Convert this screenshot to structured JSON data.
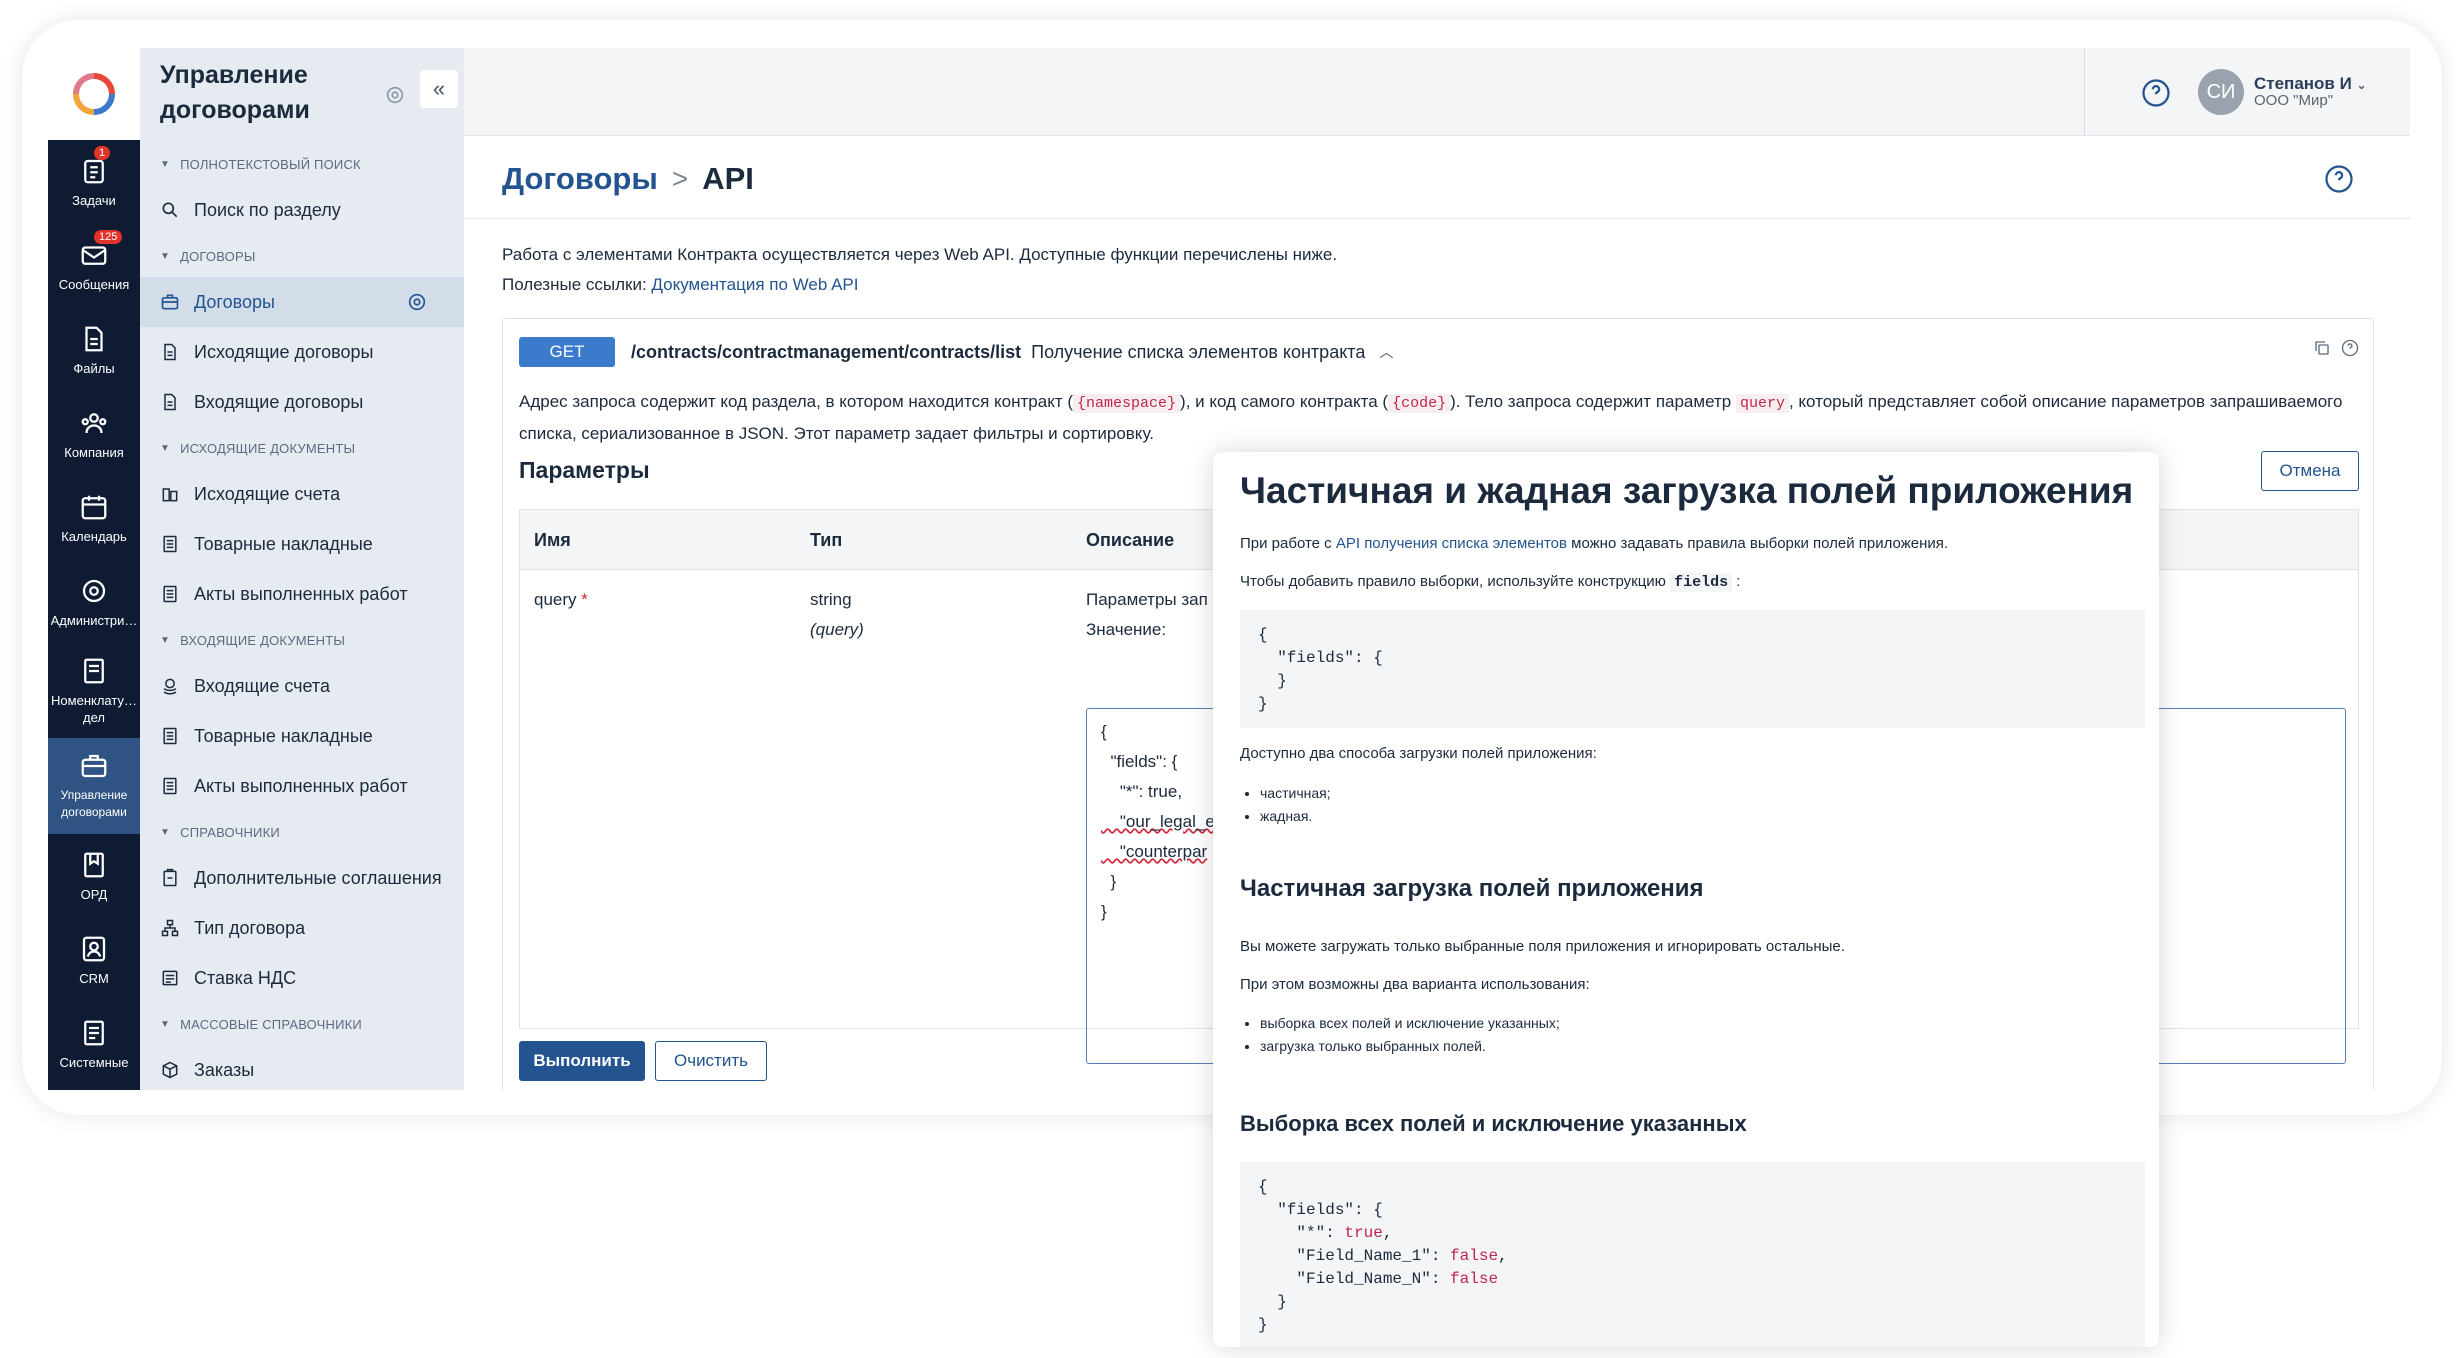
{
  "rail": {
    "items": [
      {
        "label": "Задачи",
        "icon": "tasks-icon",
        "badge": "1"
      },
      {
        "label": "Сообщения",
        "icon": "messages-icon",
        "badge": "125"
      },
      {
        "label": "Файлы",
        "icon": "files-icon",
        "badge": ""
      },
      {
        "label": "Компания",
        "icon": "company-icon",
        "badge": ""
      },
      {
        "label": "Календарь",
        "icon": "calendar-icon",
        "badge": ""
      },
      {
        "label": "Администри…",
        "icon": "admin-gear-icon",
        "badge": ""
      },
      {
        "label": "Номенклату… дел",
        "icon": "nomenclature-icon",
        "badge": ""
      },
      {
        "label": "Управление договорами",
        "icon": "contracts-icon",
        "badge": ""
      },
      {
        "label": "ОРД",
        "icon": "ord-icon",
        "badge": ""
      },
      {
        "label": "CRM",
        "icon": "crm-icon",
        "badge": ""
      },
      {
        "label": "Системные",
        "icon": "system-icon",
        "badge": ""
      }
    ]
  },
  "sidebar": {
    "title": "Управление договорами",
    "collapse_glyph": "«",
    "sections": [
      {
        "category": "Полнотекстовый поиск",
        "items": [
          {
            "label": "Поиск по разделу",
            "icon": "search-icon"
          }
        ]
      },
      {
        "category": "Договоры",
        "items": [
          {
            "label": "Договоры",
            "icon": "briefcase-icon",
            "active": true
          },
          {
            "label": "Исходящие договоры",
            "icon": "document-icon"
          },
          {
            "label": "Входящие договоры",
            "icon": "document-icon"
          }
        ]
      },
      {
        "category": "Исходящие документы",
        "items": [
          {
            "label": "Исходящие счета",
            "icon": "invoice-icon"
          },
          {
            "label": "Товарные накладные",
            "icon": "list-icon"
          },
          {
            "label": "Акты выполненных работ",
            "icon": "list-icon"
          }
        ]
      },
      {
        "category": "Входящие документы",
        "items": [
          {
            "label": "Входящие счета",
            "icon": "coins-icon"
          },
          {
            "label": "Товарные накладные",
            "icon": "list-icon"
          },
          {
            "label": "Акты выполненных работ",
            "icon": "list-icon"
          }
        ]
      },
      {
        "category": "Справочники",
        "items": [
          {
            "label": "Дополнительные соглашения",
            "icon": "clipboard-icon"
          },
          {
            "label": "Тип договора",
            "icon": "hierarchy-icon"
          },
          {
            "label": "Ставка НДС",
            "icon": "receipt-icon"
          }
        ]
      },
      {
        "category": "Массовые справочники",
        "items": [
          {
            "label": "Заказы",
            "icon": "box-icon"
          }
        ]
      }
    ]
  },
  "topbar": {
    "user_name": "Степанов И",
    "user_org": "ООО \"Мир\"",
    "avatar_initials": "СИ"
  },
  "breadcrumb": {
    "parent": "Договоры",
    "separator": ">",
    "current": "API"
  },
  "intro": {
    "line1": "Работа с элементами Контракта осуществляется через Web API. Доступные функции перечислены ниже.",
    "links_label": "Полезные ссылки:",
    "link": "Документация по Web API"
  },
  "endpoint": {
    "method": "GET",
    "path": "/contracts/contractmanagement/contracts/list",
    "description": "Получение списка элементов контракта",
    "text_a": "Адрес запроса содержит код раздела, в котором находится контракт (",
    "code_namespace": "{namespace}",
    "text_b": "), и код самого контракта (",
    "code_code": "{code}",
    "text_c": "). Тело запроса содержит параметр",
    "code_query": "query",
    "text_d": ", который представляет собой описание параметров запрашиваемого списка, сериализованное в JSON. Этот параметр задает фильтры и сортировку.",
    "params_title": "Параметры",
    "cancel_label": "Отмена",
    "table": {
      "col_name": "Имя",
      "col_type": "Тип",
      "col_desc": "Описание",
      "row_name": "query",
      "row_required": "*",
      "row_type": "string",
      "row_type_in": "(query)",
      "row_desc": "Параметры зап",
      "value_label": "Значение:",
      "value_lines": [
        "{",
        "  \"fields\": {",
        "    \"*\": true,",
        "    \"our_legal_e",
        "    \"counterpar",
        "  }",
        "}"
      ]
    },
    "run_label": "Выполнить",
    "clear_label": "Очистить"
  },
  "doc": {
    "title": "Частичная и жадная загрузка полей приложения",
    "p1_a": "При работе с",
    "p1_link": "API получения списка элементов",
    "p1_b": "можно задавать правила выборки полей приложения.",
    "p2_a": "Чтобы добавить правило выборки, используйте конструкцию",
    "p2_code": "fields",
    "p2_b": ":",
    "code1": "{\n  \"fields\": {\n  }\n}",
    "p3": "Доступно два способа загрузки полей приложения:",
    "list1": [
      "частичная;",
      "жадная."
    ],
    "h2": "Частичная загрузка полей приложения",
    "p4": "Вы можете загружать только выбранные поля приложения и игнорировать остальные.",
    "p5": "При этом возможны два варианта использования:",
    "list2": [
      "выборка всех полей и исключение указанных;",
      "загрузка только выбранных полей."
    ],
    "h3": "Выборка всех полей и исключение указанных",
    "code2_l1": "{",
    "code2_l2": "  \"fields\": {",
    "code2_l3a": "    \"*\": ",
    "code2_l3b": "true",
    "code2_l3c": ",",
    "code2_l4a": "    \"Field_Name_1\": ",
    "code2_l4b": "false",
    "code2_l4c": ",",
    "code2_l5a": "    \"Field_Name_N\": ",
    "code2_l5b": "false",
    "code2_l6": "  }",
    "code2_l7": "}"
  },
  "colors": {
    "rail_bg": "#0e1b33",
    "rail_active": "#2f5383",
    "accent": "#23548f",
    "get_badge": "#3c7bcc",
    "required": "#d1283e"
  }
}
